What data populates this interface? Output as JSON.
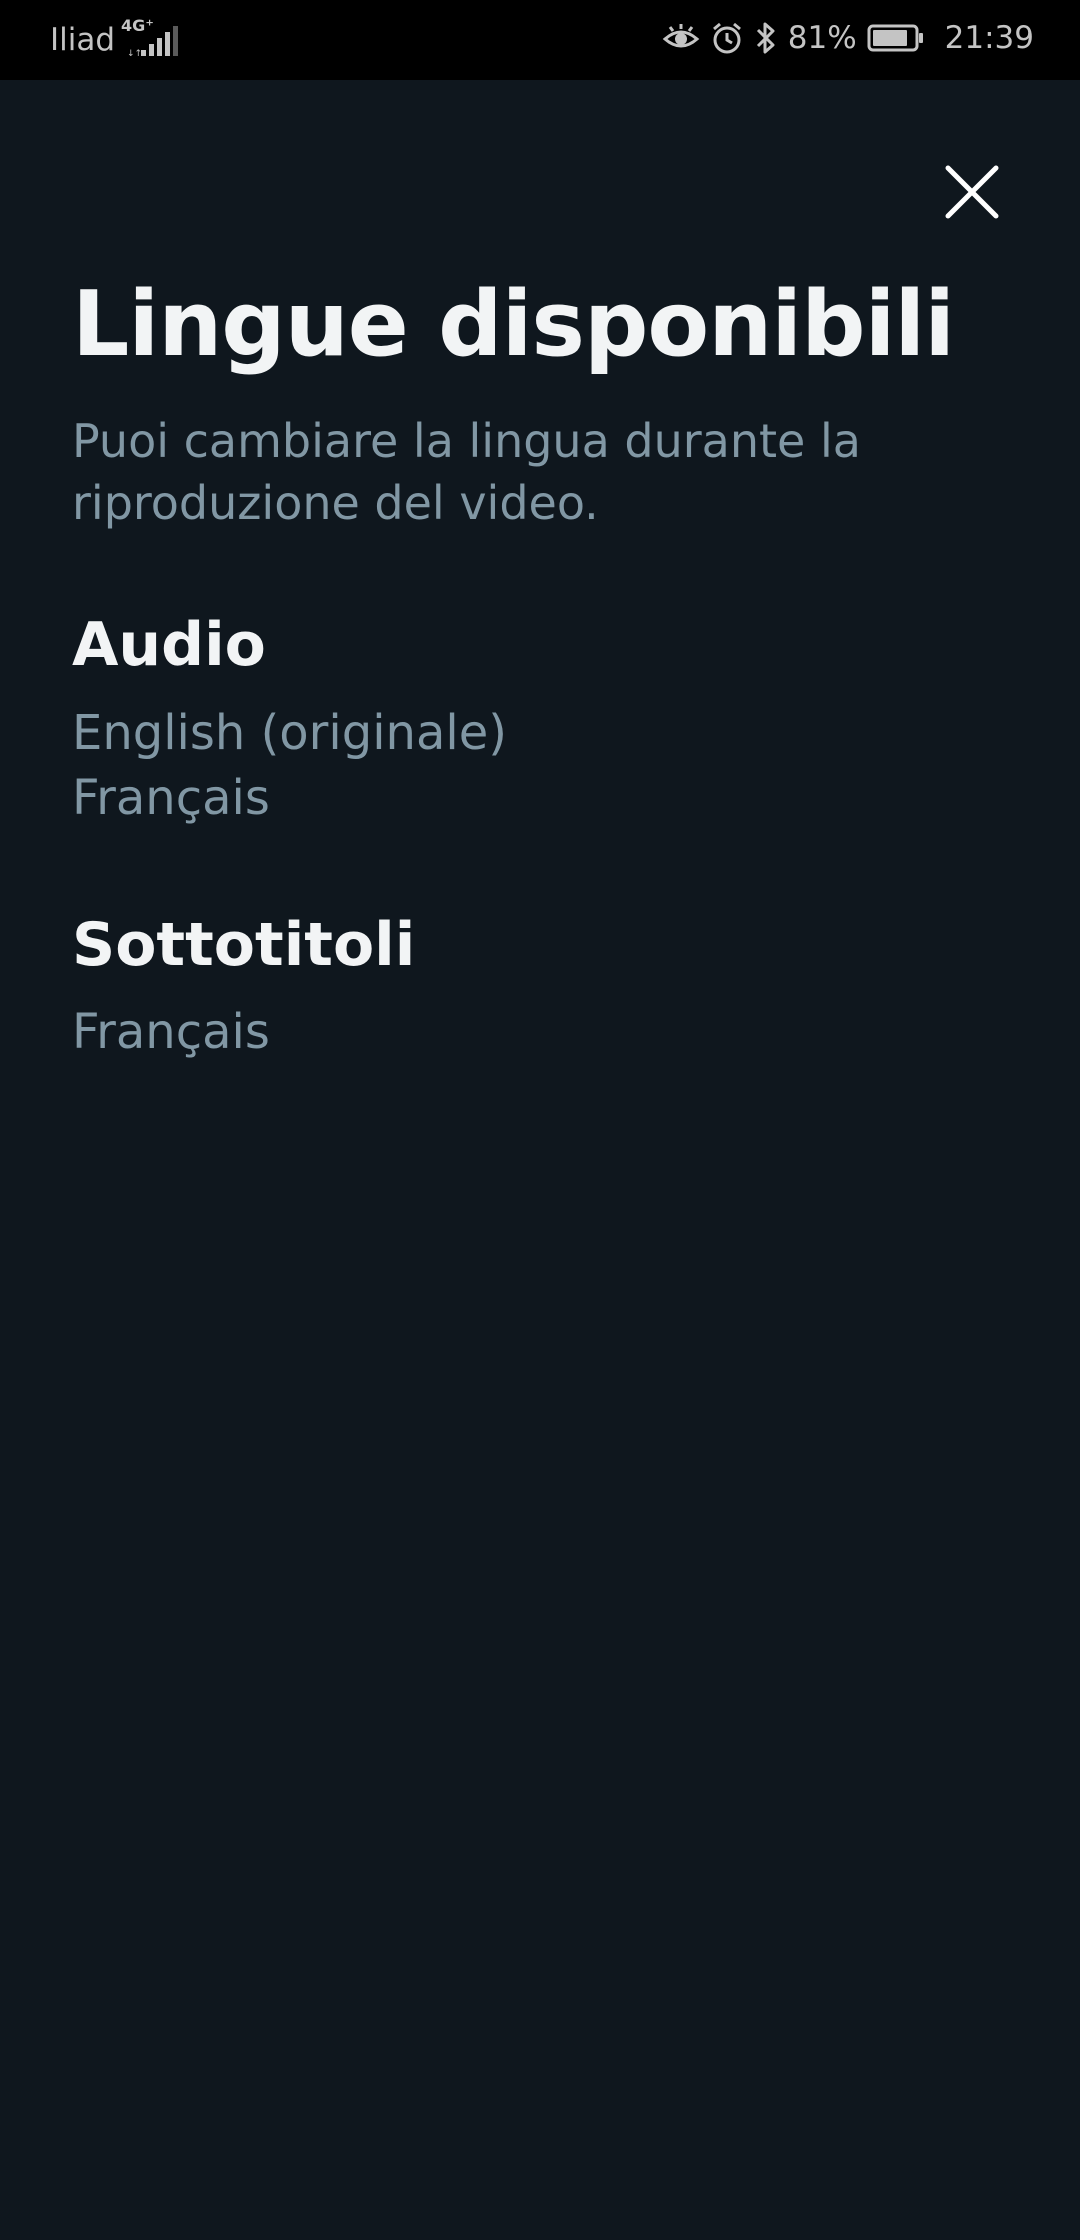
{
  "status_bar": {
    "carrier": "Iliad",
    "network_type": "4G⁺",
    "battery": "81%",
    "time": "21:39",
    "icons": [
      "eye-comfort-icon",
      "alarm-icon",
      "bluetooth-icon",
      "battery-icon",
      "signal-icon"
    ]
  },
  "header": {
    "close_icon": "close-icon"
  },
  "main": {
    "title": "Lingue disponibili",
    "subtitle": "Puoi cambiare la lingua durante la riproduzione del video."
  },
  "audio": {
    "title": "Audio",
    "languages": [
      "English (originale)",
      "Français"
    ]
  },
  "subtitles": {
    "title": "Sottotitoli",
    "languages": [
      "Français"
    ]
  },
  "colors": {
    "background": "#0f171e",
    "status_bar": "#000000",
    "heading": "#f2f4f5",
    "secondary_text": "#8197a4"
  }
}
